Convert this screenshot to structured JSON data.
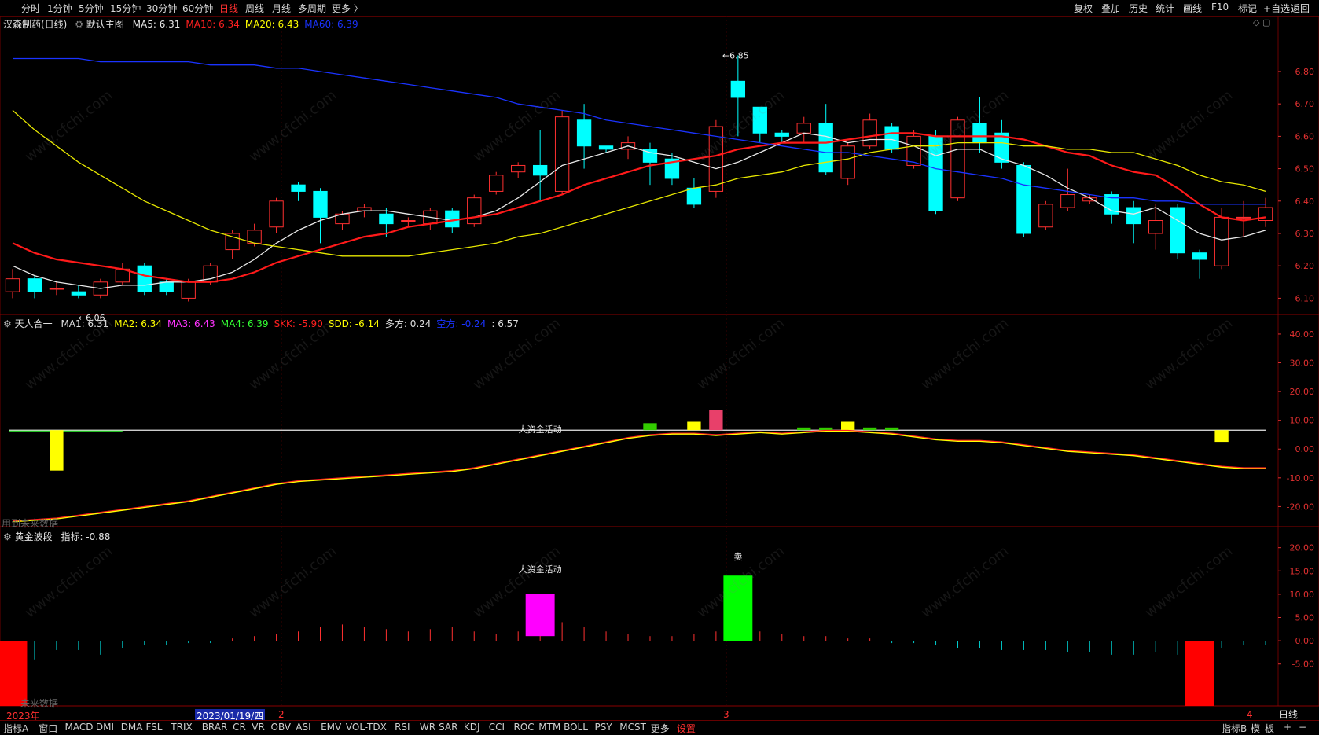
{
  "toolbar": {
    "periods": [
      "分时",
      "1分钟",
      "5分钟",
      "15分钟",
      "30分钟",
      "60分钟",
      "日线",
      "周线",
      "月线",
      "多周期",
      "更多 〉"
    ],
    "active_period": "日线",
    "right_tools": [
      "复权",
      "叠加",
      "历史",
      "统计",
      "画线",
      "F10",
      "标记",
      "+自选",
      "返回"
    ]
  },
  "bottombar": {
    "tabs": [
      "指标A",
      "窗口",
      "MACD",
      "DMI",
      "DMA",
      "FSL",
      "TRIX",
      "BRAR",
      "CR",
      "VR",
      "OBV",
      "ASI",
      "EMV",
      "VOL-TDX",
      "RSI",
      "WR",
      "SAR",
      "KDJ",
      "CCI",
      "ROC",
      "MTM",
      "BOLL",
      "PSY",
      "MCST",
      "更多",
      "设置"
    ],
    "right": [
      "指标B",
      "模",
      "板",
      "+",
      "−"
    ],
    "period_tag": "日线"
  },
  "colors": {
    "up": "#ff3030",
    "down": "#00ffff",
    "ma5": "#e8e8e8",
    "ma10": "#ff1a1a",
    "ma20": "#e6e600",
    "ma60": "#1a33ff",
    "grid": "#6a0000",
    "axis": "#e03030"
  },
  "main_legend": {
    "stock": "汉森制药(日线)",
    "template": "默认主图",
    "items": [
      {
        "label": "MA5: 6.31",
        "color": "#e8e8e8"
      },
      {
        "label": "MA10: 6.34",
        "color": "#ff2020"
      },
      {
        "label": "MA20: 6.43",
        "color": "#ffff00"
      },
      {
        "label": "MA60: 6.39",
        "color": "#1a33ff"
      }
    ]
  },
  "ind1_legend": {
    "name": "天人合一",
    "items": [
      {
        "label": "MA1: 6.31",
        "color": "#e0e0e0"
      },
      {
        "label": "MA2: 6.34",
        "color": "#ffff00"
      },
      {
        "label": "MA3: 6.43",
        "color": "#ff33ff"
      },
      {
        "label": "MA4: 6.39",
        "color": "#33ff33"
      },
      {
        "label": "SKK: -5.90",
        "color": "#ff2020"
      },
      {
        "label": "SDD: -6.14",
        "color": "#ffff00"
      },
      {
        "label": "多方: 0.24",
        "color": "#e0e0e0"
      },
      {
        "label": "空方: -0.24",
        "color": "#1a33ff"
      },
      {
        "label": ": 6.57",
        "color": "#e0e0e0"
      }
    ],
    "note": "用到未来数据",
    "annotation": "大资金活动"
  },
  "ind2_legend": {
    "name": "黄金波段",
    "items": [
      {
        "label": "指标: -0.88",
        "color": "#e0e0e0"
      }
    ],
    "note": "未来数据",
    "annotation": "大资金活动",
    "sell_mark": "卖"
  },
  "date_axis": {
    "year": "2023年",
    "cursor_date": "2023/01/19/四",
    "month_marks": [
      "2",
      "3",
      "4"
    ]
  },
  "watermark": "www.cfchi.com",
  "chart_data": [
    {
      "type": "candlestick",
      "title": "汉森制药(日线)",
      "ylim": [
        6.05,
        6.88
      ],
      "yticks": [
        6.1,
        6.2,
        6.3,
        6.4,
        6.5,
        6.6,
        6.7,
        6.8
      ],
      "annotations": [
        {
          "text": "6.85",
          "bar": 32,
          "price": 6.85
        },
        {
          "text": "6.06",
          "bar": 3,
          "price": 6.06
        }
      ],
      "candles": [
        [
          6.12,
          6.16,
          6.19,
          6.1
        ],
        [
          6.16,
          6.12,
          6.17,
          6.1
        ],
        [
          6.13,
          6.13,
          6.15,
          6.11
        ],
        [
          6.12,
          6.11,
          6.14,
          6.1
        ],
        [
          6.11,
          6.15,
          6.16,
          6.1
        ],
        [
          6.15,
          6.19,
          6.21,
          6.14
        ],
        [
          6.2,
          6.12,
          6.21,
          6.11
        ],
        [
          6.15,
          6.12,
          6.16,
          6.11
        ],
        [
          6.1,
          6.15,
          6.16,
          6.09
        ],
        [
          6.15,
          6.2,
          6.21,
          6.14
        ],
        [
          6.25,
          6.3,
          6.31,
          6.22
        ],
        [
          6.27,
          6.31,
          6.33,
          6.26
        ],
        [
          6.32,
          6.4,
          6.41,
          6.3
        ],
        [
          6.45,
          6.43,
          6.46,
          6.4
        ],
        [
          6.43,
          6.35,
          6.44,
          6.27
        ],
        [
          6.33,
          6.36,
          6.37,
          6.31
        ],
        [
          6.37,
          6.38,
          6.39,
          6.35
        ],
        [
          6.36,
          6.33,
          6.38,
          6.29
        ],
        [
          6.34,
          6.34,
          6.35,
          6.32
        ],
        [
          6.33,
          6.37,
          6.38,
          6.31
        ],
        [
          6.37,
          6.32,
          6.38,
          6.3
        ],
        [
          6.33,
          6.41,
          6.42,
          6.32
        ],
        [
          6.43,
          6.48,
          6.49,
          6.42
        ],
        [
          6.49,
          6.51,
          6.52,
          6.47
        ],
        [
          6.51,
          6.48,
          6.62,
          6.4
        ],
        [
          6.43,
          6.66,
          6.68,
          6.42
        ],
        [
          6.65,
          6.57,
          6.7,
          6.5
        ],
        [
          6.57,
          6.56,
          6.57,
          6.55
        ],
        [
          6.56,
          6.58,
          6.6,
          6.53
        ],
        [
          6.56,
          6.52,
          6.58,
          6.45
        ],
        [
          6.53,
          6.47,
          6.55,
          6.45
        ],
        [
          6.44,
          6.39,
          6.47,
          6.38
        ],
        [
          6.43,
          6.63,
          6.65,
          6.41
        ],
        [
          6.77,
          6.72,
          6.85,
          6.6
        ],
        [
          6.69,
          6.61,
          6.69,
          6.58
        ],
        [
          6.61,
          6.6,
          6.62,
          6.58
        ],
        [
          6.61,
          6.64,
          6.66,
          6.58
        ],
        [
          6.64,
          6.49,
          6.7,
          6.48
        ],
        [
          6.47,
          6.57,
          6.58,
          6.45
        ],
        [
          6.57,
          6.65,
          6.67,
          6.56
        ],
        [
          6.63,
          6.56,
          6.64,
          6.55
        ],
        [
          6.51,
          6.6,
          6.62,
          6.5
        ],
        [
          6.6,
          6.37,
          6.62,
          6.36
        ],
        [
          6.41,
          6.65,
          6.66,
          6.4
        ],
        [
          6.64,
          6.58,
          6.72,
          6.55
        ],
        [
          6.61,
          6.52,
          6.65,
          6.5
        ],
        [
          6.51,
          6.3,
          6.52,
          6.29
        ],
        [
          6.32,
          6.39,
          6.4,
          6.31
        ],
        [
          6.38,
          6.42,
          6.5,
          6.37
        ],
        [
          6.4,
          6.41,
          6.42,
          6.39
        ],
        [
          6.42,
          6.36,
          6.43,
          6.33
        ],
        [
          6.38,
          6.33,
          6.4,
          6.27
        ],
        [
          6.3,
          6.34,
          6.39,
          6.25
        ],
        [
          6.38,
          6.24,
          6.39,
          6.22
        ],
        [
          6.24,
          6.22,
          6.25,
          6.16
        ],
        [
          6.2,
          6.35,
          6.38,
          6.19
        ],
        [
          6.35,
          6.35,
          6.4,
          6.29
        ],
        [
          6.34,
          6.38,
          6.41,
          6.32
        ]
      ],
      "series": [
        {
          "name": "MA5",
          "color": "#e8e8e8",
          "values": [
            6.2,
            6.17,
            6.15,
            6.14,
            6.13,
            6.14,
            6.14,
            6.15,
            6.15,
            6.16,
            6.18,
            6.22,
            6.27,
            6.31,
            6.34,
            6.36,
            6.37,
            6.37,
            6.36,
            6.35,
            6.34,
            6.35,
            6.37,
            6.41,
            6.46,
            6.51,
            6.53,
            6.55,
            6.57,
            6.55,
            6.54,
            6.52,
            6.5,
            6.52,
            6.55,
            6.58,
            6.61,
            6.6,
            6.58,
            6.59,
            6.59,
            6.57,
            6.54,
            6.56,
            6.56,
            6.53,
            6.51,
            6.48,
            6.44,
            6.41,
            6.37,
            6.36,
            6.38,
            6.34,
            6.3,
            6.28,
            6.29,
            6.31
          ]
        },
        {
          "name": "MA10",
          "color": "#ff1a1a",
          "values": [
            6.27,
            6.24,
            6.22,
            6.21,
            6.2,
            6.19,
            6.17,
            6.16,
            6.15,
            6.15,
            6.16,
            6.18,
            6.21,
            6.23,
            6.25,
            6.27,
            6.29,
            6.3,
            6.32,
            6.33,
            6.34,
            6.35,
            6.36,
            6.38,
            6.4,
            6.42,
            6.45,
            6.47,
            6.49,
            6.51,
            6.52,
            6.53,
            6.54,
            6.56,
            6.57,
            6.58,
            6.58,
            6.58,
            6.59,
            6.6,
            6.61,
            6.61,
            6.6,
            6.6,
            6.6,
            6.6,
            6.59,
            6.57,
            6.55,
            6.54,
            6.51,
            6.49,
            6.48,
            6.44,
            6.39,
            6.35,
            6.34,
            6.35
          ]
        },
        {
          "name": "MA20",
          "color": "#e6e600",
          "values": [
            6.68,
            6.62,
            6.57,
            6.52,
            6.48,
            6.44,
            6.4,
            6.37,
            6.34,
            6.31,
            6.29,
            6.27,
            6.26,
            6.25,
            6.24,
            6.23,
            6.23,
            6.23,
            6.23,
            6.24,
            6.25,
            6.26,
            6.27,
            6.29,
            6.3,
            6.32,
            6.34,
            6.36,
            6.38,
            6.4,
            6.42,
            6.44,
            6.45,
            6.47,
            6.48,
            6.49,
            6.51,
            6.52,
            6.53,
            6.55,
            6.56,
            6.57,
            6.57,
            6.58,
            6.58,
            6.58,
            6.57,
            6.57,
            6.56,
            6.56,
            6.55,
            6.55,
            6.53,
            6.51,
            6.48,
            6.46,
            6.45,
            6.43
          ]
        },
        {
          "name": "MA60",
          "color": "#1a33ff",
          "values": [
            6.84,
            6.84,
            6.84,
            6.84,
            6.83,
            6.83,
            6.83,
            6.83,
            6.83,
            6.82,
            6.82,
            6.82,
            6.81,
            6.81,
            6.8,
            6.79,
            6.78,
            6.77,
            6.76,
            6.75,
            6.74,
            6.73,
            6.72,
            6.7,
            6.69,
            6.68,
            6.67,
            6.65,
            6.64,
            6.63,
            6.62,
            6.61,
            6.6,
            6.59,
            6.58,
            6.57,
            6.56,
            6.55,
            6.55,
            6.54,
            6.53,
            6.52,
            6.5,
            6.49,
            6.48,
            6.47,
            6.45,
            6.44,
            6.43,
            6.42,
            6.41,
            6.41,
            6.4,
            6.4,
            6.39,
            6.39,
            6.39,
            6.39
          ]
        }
      ]
    },
    {
      "type": "bar",
      "title": "天人合一",
      "ylim": [
        -27,
        46
      ],
      "yticks": [
        -20,
        -10,
        0,
        10,
        20,
        30,
        40
      ],
      "baseline": 6.57,
      "series": [
        {
          "name": "SKK",
          "color": "#ff2020",
          "values": [
            -25,
            -24.5,
            -24,
            -23,
            -22,
            -21,
            -20,
            -19,
            -18,
            -16.5,
            -15,
            -13.5,
            -12,
            -11,
            -10.5,
            -10,
            -9.5,
            -9,
            -8.5,
            -8,
            -7.5,
            -6.5,
            -5,
            -3.5,
            -2,
            -0.5,
            1,
            2.5,
            4,
            5,
            5.5,
            5.5,
            5,
            5.5,
            6,
            5.5,
            6,
            6.5,
            6.5,
            6,
            5.5,
            4.5,
            3.5,
            3,
            3,
            2.5,
            1.5,
            0.5,
            -0.5,
            -1,
            -1.5,
            -2,
            -3,
            -4,
            -5,
            -6,
            -6.5,
            -6.5
          ]
        },
        {
          "name": "SDD",
          "color": "#ffff00",
          "values": [
            -25.3,
            -24.8,
            -24.3,
            -23.3,
            -22.3,
            -21.3,
            -20.3,
            -19.3,
            -18.3,
            -16.8,
            -15.3,
            -13.8,
            -12.3,
            -11.3,
            -10.8,
            -10.3,
            -9.8,
            -9.3,
            -8.8,
            -8.3,
            -7.8,
            -6.8,
            -5.3,
            -3.8,
            -2.3,
            -0.8,
            0.7,
            2.2,
            3.7,
            4.7,
            5.2,
            5.2,
            4.7,
            5.2,
            5.7,
            5.2,
            5.7,
            6.2,
            6.2,
            5.7,
            5.2,
            4.2,
            3.2,
            2.7,
            2.7,
            2.2,
            1.2,
            0.2,
            -0.8,
            -1.3,
            -1.8,
            -2.3,
            -3.3,
            -4.3,
            -5.3,
            -6.3,
            -6.8,
            -6.8
          ]
        }
      ],
      "bars": [
        {
          "bar": 2,
          "from": 6.57,
          "to": -7.5,
          "color": "#ffff00"
        },
        {
          "bar": 29,
          "from": 6.57,
          "to": 9,
          "color": "#33cc00"
        },
        {
          "bar": 31,
          "from": 6.57,
          "to": 9.5,
          "color": "#ffff00"
        },
        {
          "bar": 32,
          "from": 6.57,
          "to": 13.5,
          "color": "#e8406a"
        },
        {
          "bar": 36,
          "from": 6.57,
          "to": 7.5,
          "color": "#33cc00"
        },
        {
          "bar": 37,
          "from": 6.57,
          "to": 7.5,
          "color": "#33cc00"
        },
        {
          "bar": 38,
          "from": 6.57,
          "to": 9.5,
          "color": "#ffff00"
        },
        {
          "bar": 39,
          "from": 6.57,
          "to": 7.5,
          "color": "#33cc00"
        },
        {
          "bar": 40,
          "from": 6.57,
          "to": 7.5,
          "color": "#33cc00"
        },
        {
          "bar": 55,
          "from": 6.57,
          "to": 2.5,
          "color": "#ffff00"
        }
      ]
    },
    {
      "type": "bar",
      "title": "黄金波段",
      "ylim": [
        -14,
        24
      ],
      "yticks": [
        -5,
        0,
        5,
        10,
        15,
        20
      ],
      "blocks": [
        {
          "bar": 0,
          "from": 0,
          "to": -14,
          "color": "#ff0000"
        },
        {
          "bar": 24,
          "from": 1,
          "to": 10,
          "color": "#ff00ff"
        },
        {
          "bar": 33,
          "from": 0,
          "to": 14,
          "color": "#00ff00"
        },
        {
          "bar": 54,
          "from": 0,
          "to": -14,
          "color": "#ff0000"
        }
      ],
      "ticks": [
        -2,
        -4,
        -2,
        -2,
        -3,
        -1.5,
        -1,
        -1,
        -0.5,
        -0.5,
        0.5,
        1,
        1.5,
        2,
        3,
        3.5,
        3,
        2.5,
        2,
        2.5,
        3,
        2,
        1.5,
        2,
        3,
        4,
        3,
        2,
        1.5,
        1,
        1,
        1.5,
        2,
        3,
        2,
        1.5,
        1,
        1,
        0.5,
        0.5,
        -0.5,
        -0.5,
        -1,
        -1.5,
        -1.5,
        -2,
        -2,
        -2,
        -2.5,
        -2.5,
        -3,
        -3,
        -2.5,
        -3,
        -2.5,
        -1.5,
        -1,
        -0.88
      ]
    }
  ]
}
